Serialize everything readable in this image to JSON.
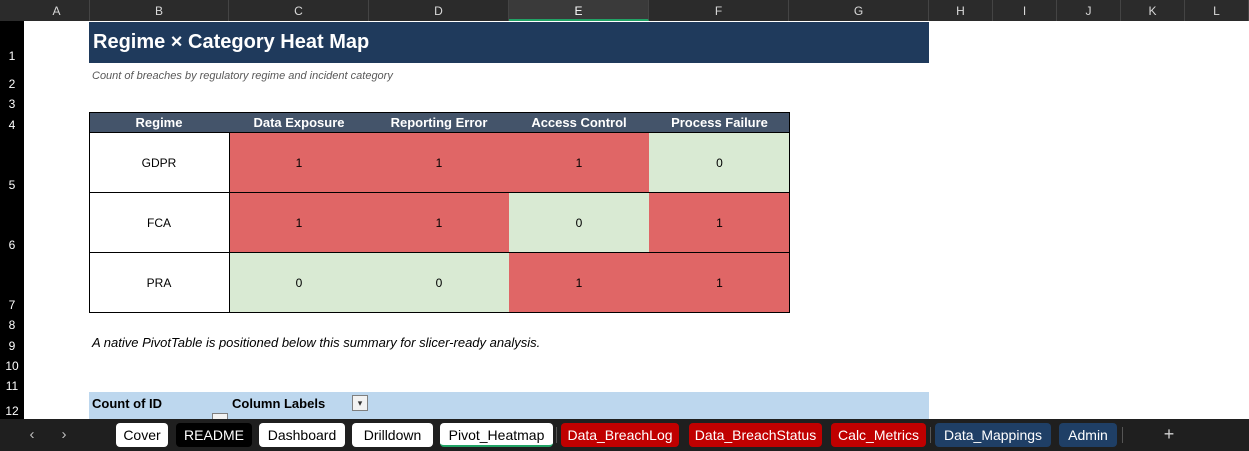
{
  "columns": [
    "A",
    "B",
    "C",
    "D",
    "E",
    "F",
    "G",
    "H",
    "I",
    "J",
    "K",
    "L"
  ],
  "rows": [
    "1",
    "2",
    "3",
    "4",
    "5",
    "6",
    "7",
    "8",
    "9",
    "10",
    "11",
    "12"
  ],
  "sheet": {
    "title": "Regime × Category Heat Map",
    "subtitle": "Count of breaches by regulatory regime and incident category",
    "note": "A native PivotTable is positioned below this summary for slicer-ready analysis."
  },
  "heatmap": {
    "headers": [
      "Regime",
      "Data Exposure",
      "Reporting Error",
      "Access Control",
      "Process Failure"
    ],
    "rows": [
      {
        "regime": "GDPR",
        "values": [
          "1",
          "1",
          "1",
          "0"
        ]
      },
      {
        "regime": "FCA",
        "values": [
          "1",
          "1",
          "0",
          "1"
        ]
      },
      {
        "regime": "PRA",
        "values": [
          "0",
          "0",
          "1",
          "1"
        ]
      }
    ],
    "colors": {
      "hot": "#e06666",
      "cold": "#d9ead3",
      "header": "#44546a"
    }
  },
  "pivot": {
    "value_label": "Count of ID",
    "column_labels": "Column Labels"
  },
  "tabs": [
    {
      "label": "Cover",
      "style": "white"
    },
    {
      "label": "README",
      "style": "black"
    },
    {
      "label": "Dashboard",
      "style": "white"
    },
    {
      "label": "Drilldown",
      "style": "white"
    },
    {
      "label": "Pivot_Heatmap",
      "style": "active"
    },
    {
      "label": "Data_BreachLog",
      "style": "red"
    },
    {
      "label": "Data_BreachStatus",
      "style": "red"
    },
    {
      "label": "Calc_Metrics",
      "style": "red"
    },
    {
      "label": "Data_Mappings",
      "style": "blue"
    },
    {
      "label": "Admin",
      "style": "blue"
    }
  ],
  "icons": {
    "prev": "chevron-left-icon",
    "next": "chevron-right-icon",
    "add": "plus-icon",
    "filter": "dropdown-arrow-icon"
  }
}
